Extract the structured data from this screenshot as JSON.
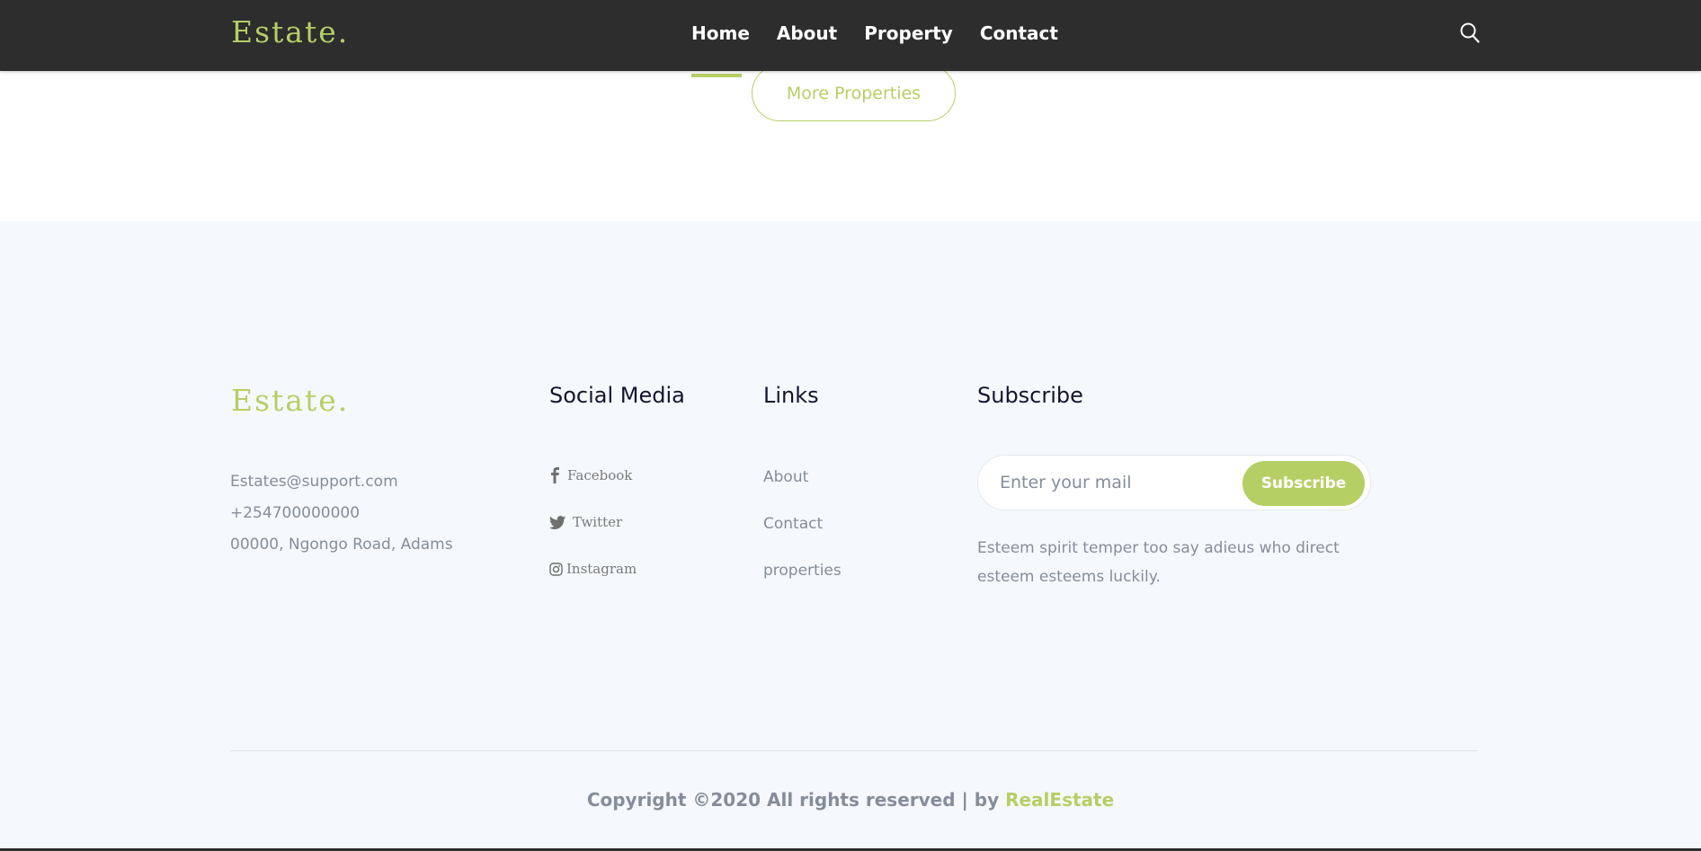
{
  "header": {
    "logo": "Estate.",
    "nav": [
      "Home",
      "About",
      "Property",
      "Contact"
    ],
    "search_icon": "search-icon"
  },
  "properties": {
    "more_button": "More Properties"
  },
  "footer": {
    "logo": "Estate.",
    "contact": {
      "email": "Estates@support.com",
      "phone": "+254700000000",
      "address": "00000, Ngongo Road, Adams"
    },
    "social": {
      "title": "Social Media",
      "items": [
        {
          "label": "Facebook",
          "icon": "facebook-icon"
        },
        {
          "label": "Twitter",
          "icon": "twitter-icon"
        },
        {
          "label": "Instagram",
          "icon": "instagram-icon"
        }
      ]
    },
    "links": {
      "title": "Links",
      "items": [
        "About",
        "Contact",
        "properties"
      ]
    },
    "subscribe": {
      "title": "Subscribe",
      "placeholder": "Enter your mail",
      "button": "Subscribe",
      "text": "Esteem spirit temper too say adieus who direct esteem esteems luckily."
    },
    "copyright": {
      "text": "Copyright ©2020 All rights reserved | by",
      "brand": "RealEstate"
    }
  },
  "colors": {
    "accent": "#b6cf65",
    "header_bg": "#2d2d2d",
    "footer_bg": "#f5f9fd"
  }
}
